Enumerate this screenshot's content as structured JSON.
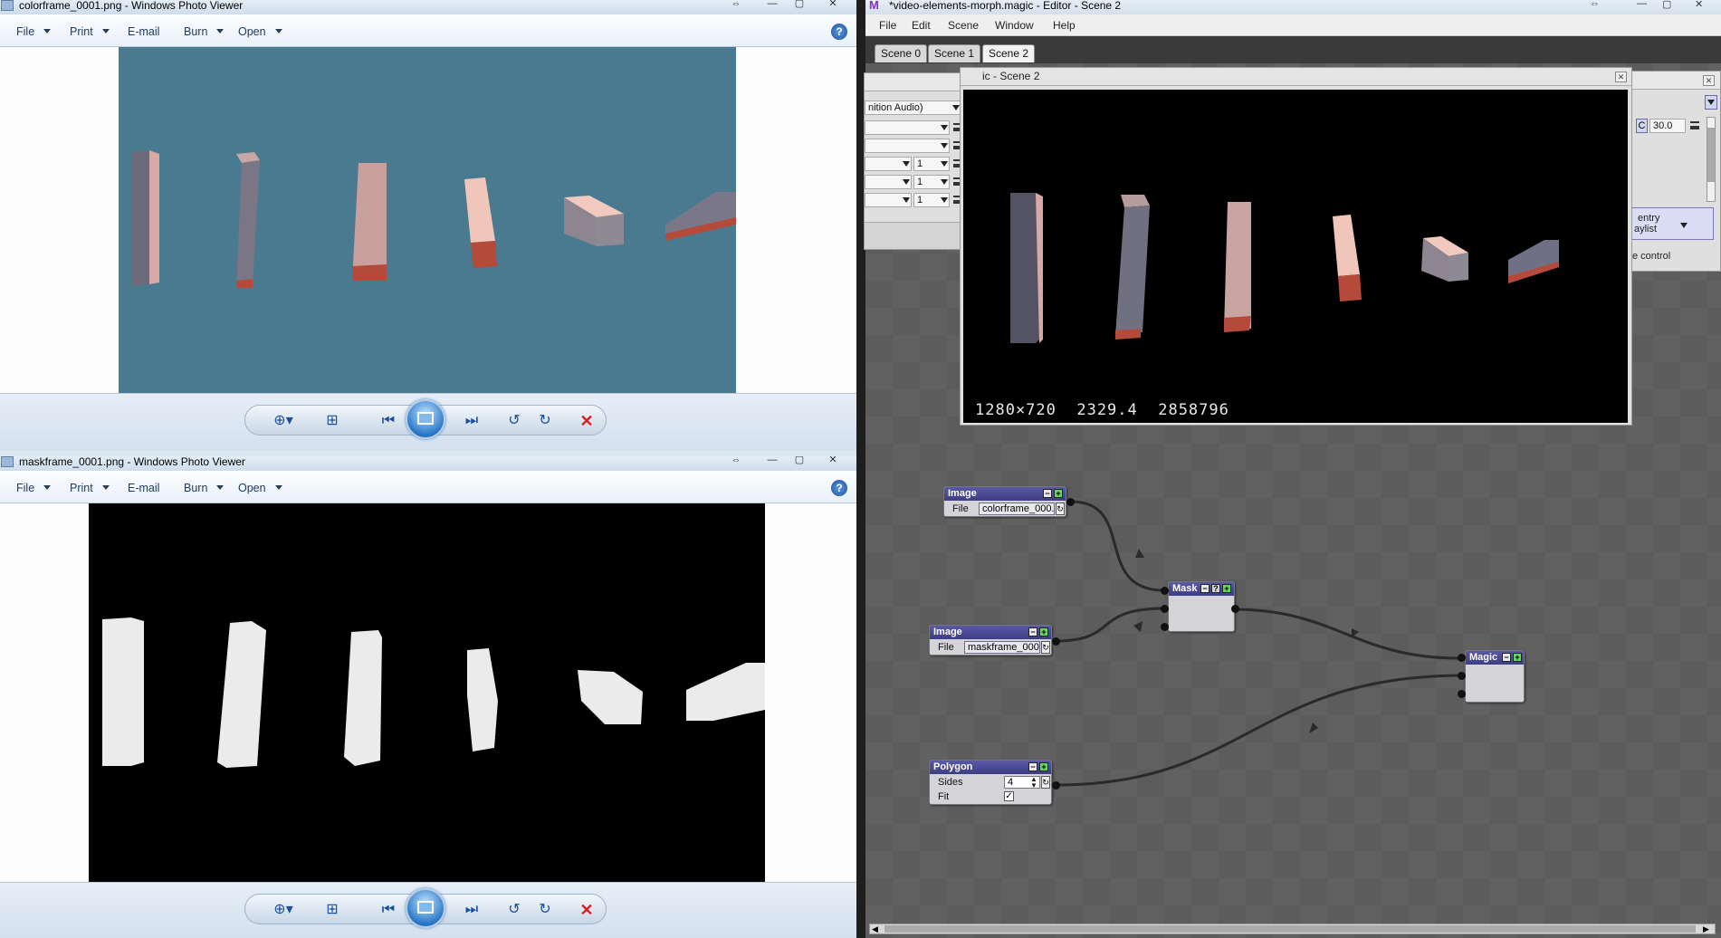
{
  "viewer_top": {
    "title": "colorframe_0001.png - Windows Photo Viewer",
    "menu": [
      "File",
      "Print",
      "E-mail",
      "Burn",
      "Open"
    ],
    "help": "?"
  },
  "viewer_bottom": {
    "title": "maskframe_0001.png - Windows Photo Viewer",
    "menu": [
      "File",
      "Print",
      "E-mail",
      "Burn",
      "Open"
    ],
    "help": "?"
  },
  "editor": {
    "title": "*video-elements-morph.magic - Editor - Scene 2",
    "menu": [
      "File",
      "Edit",
      "Scene",
      "Window",
      "Help"
    ],
    "tabs": [
      "Scene 0",
      "Scene 1",
      "Scene 2"
    ],
    "active_tab": "Scene 2",
    "left_panel": {
      "audio_label": "nition Audio)",
      "fields": [
        "1",
        "1",
        "1"
      ]
    },
    "preview": {
      "title": "ic - Scene 2",
      "stats": "1280×720  2329.4  2858796"
    },
    "right_panel": {
      "value_prefix": "C",
      "value": "30.0",
      "entry_line1": "entry",
      "entry_line2": "aylist",
      "control_label": "e control"
    },
    "nodes": {
      "image1": {
        "title": "Image",
        "label": "File",
        "value": "colorframe_000..."
      },
      "image2": {
        "title": "Image",
        "label": "File",
        "value": "maskframe_000..."
      },
      "mask": {
        "title": "Mask"
      },
      "magic": {
        "title": "Magic"
      },
      "polygon": {
        "title": "Polygon",
        "sides_label": "Sides",
        "sides_value": "4",
        "fit_label": "Fit",
        "fit_checked": "✓"
      }
    }
  },
  "colors": {
    "photo_background": "#4a7a8f",
    "node_header": "#46468c",
    "close_red": "#d82020"
  }
}
